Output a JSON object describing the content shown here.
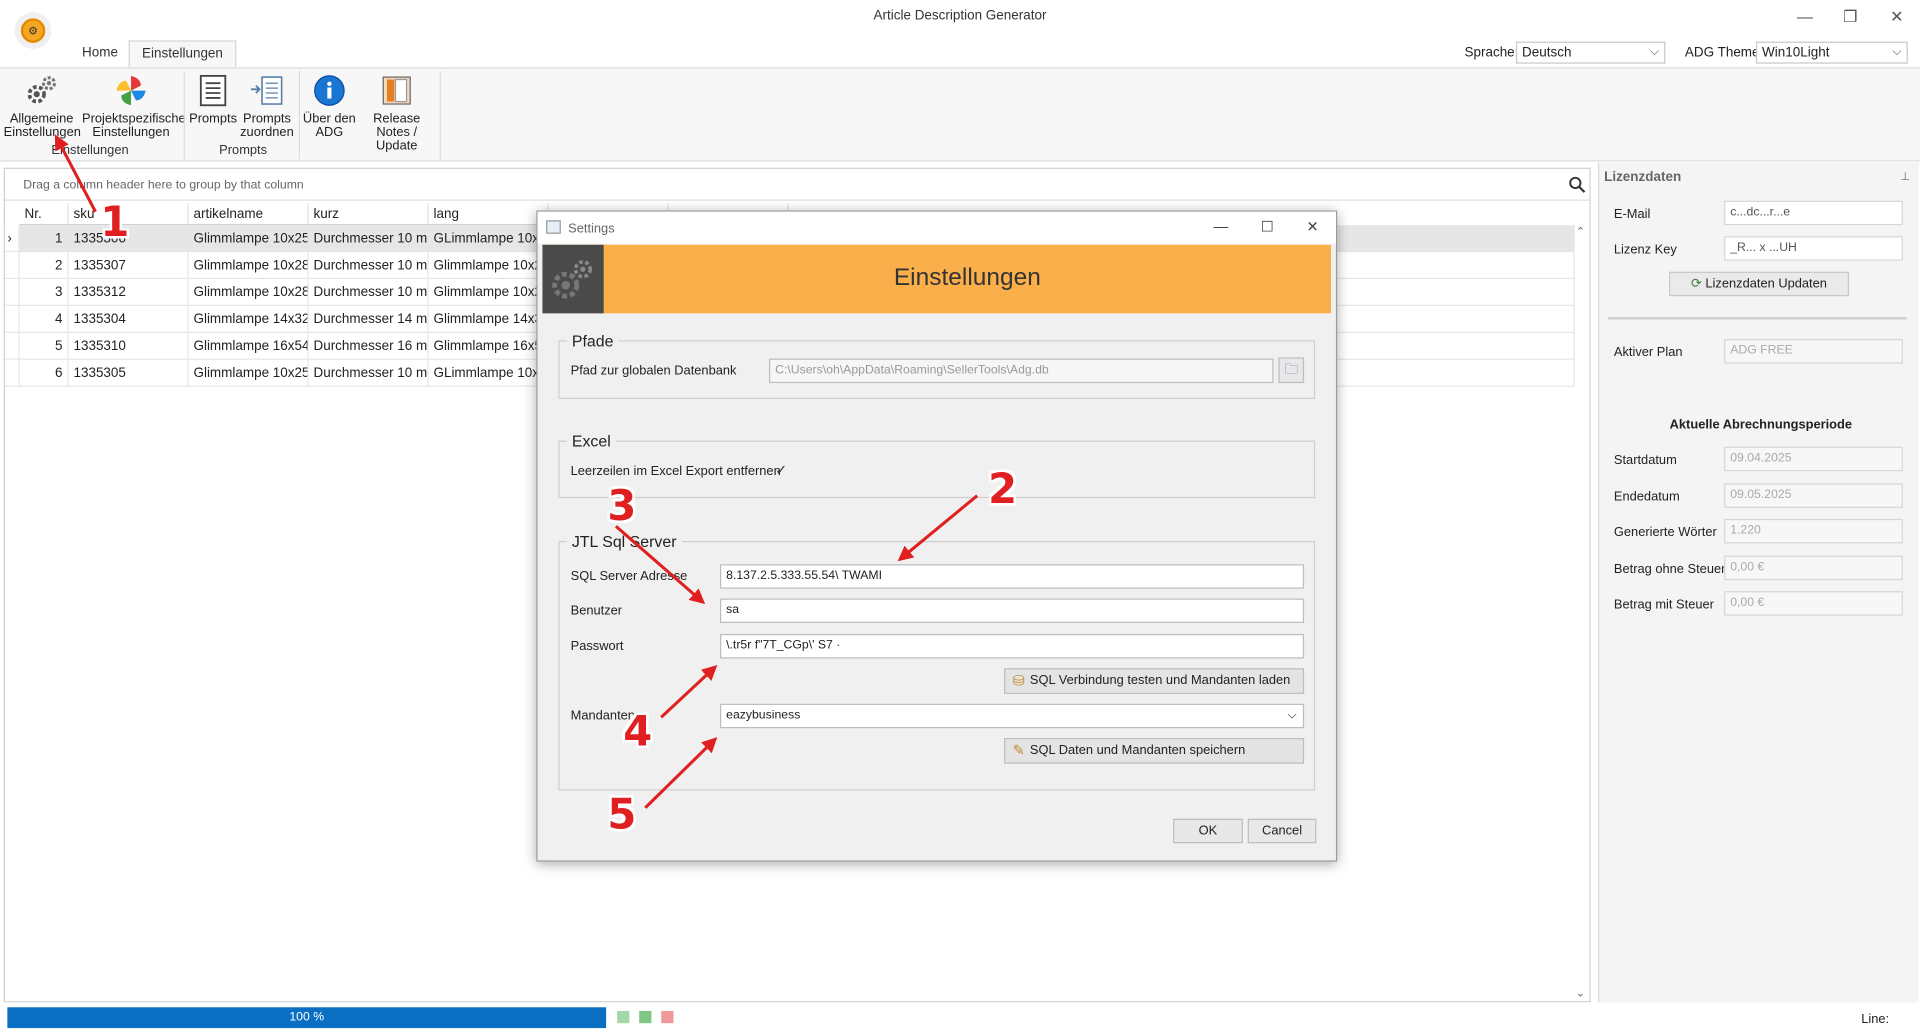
{
  "window": {
    "title": "Article Description Generator",
    "minimize": "—",
    "maximize": "❐",
    "close": "✕"
  },
  "tabs": [
    {
      "label": "Home"
    },
    {
      "label": "Einstellungen"
    }
  ],
  "topbar": {
    "language_label": "Sprache:",
    "language_value": "Deutsch",
    "theme_label": "ADG Theme:",
    "theme_value": "Win10Light",
    "dropdown_arrow": "⌵"
  },
  "ribbon": {
    "general_settings": "Allgemeine Einstellungen",
    "project_settings": "Projektspezifische Einstellungen",
    "prompts": "Prompts",
    "assign_prompts": "Prompts zuordnen",
    "about": "Über den ADG",
    "release_notes": "Release Notes / Update",
    "group_settings": "Einstellungen",
    "group_prompts": "Prompts"
  },
  "grid": {
    "group_hint": "Drag a column header here to group by that column",
    "columns": [
      "Nr.",
      "sku",
      "artikelname",
      "kurz",
      "lang"
    ],
    "rows": [
      {
        "nr": "1",
        "sku": "1335306",
        "name": "Glimmlampe 10x25...",
        "kurz": "Durchmesser 10 m...",
        "lang": "GLimmlampe 10x2..."
      },
      {
        "nr": "2",
        "sku": "1335307",
        "name": "Glimmlampe 10x28...",
        "kurz": "Durchmesser 10 m...",
        "lang": "Glimmlampe 10x2..."
      },
      {
        "nr": "3",
        "sku": "1335312",
        "name": "Glimmlampe 10x28...",
        "kurz": "Durchmesser 10 m...",
        "lang": "Glimmlampe 10x28..."
      },
      {
        "nr": "4",
        "sku": "1335304",
        "name": "Glimmlampe 14x32...",
        "kurz": "Durchmesser 14 m...",
        "lang": "Glimmlampe 14x32..."
      },
      {
        "nr": "5",
        "sku": "1335310",
        "name": "Glimmlampe 16x54...",
        "kurz": "Durchmesser 16 m...",
        "lang": "Glimmlampe 16x54..."
      },
      {
        "nr": "6",
        "sku": "1335305",
        "name": "Glimmlampe 10x25...",
        "kurz": "Durchmesser 10 m...",
        "lang": "GLimmlampe 10x2..."
      }
    ],
    "row_indicator": "›"
  },
  "status": {
    "progress_text": "100 %",
    "progress": 1.0,
    "line_label": "Line:"
  },
  "license": {
    "panel_title": "Lizenzdaten",
    "pin": "📌",
    "email_label": "E-Mail",
    "email_value": "c...dc...r...e",
    "key_label": "Lizenz Key",
    "key_value": "_R... x ...UH",
    "update_button": "Lizenzdaten Updaten",
    "plan_label": "Aktiver Plan",
    "plan_value": "ADG FREE",
    "period_title": "Aktuelle Abrechnungsperiode",
    "start_label": "Startdatum",
    "start_value": "09.04.2025",
    "end_label": "Endedatum",
    "end_value": "09.05.2025",
    "words_label": "Generierte Wörter",
    "words_value": "1.220",
    "net_label": "Betrag ohne Steuer",
    "net_value": "0,00 €",
    "gross_label": "Betrag mit Steuer",
    "gross_value": "0,00 €"
  },
  "dialog": {
    "title": "Settings",
    "banner": "Einstellungen",
    "paths_title": "Pfade",
    "db_path_label": "Pfad zur globalen Datenbank",
    "db_path_value": "C:\\Users\\oh\\AppData\\Roaming\\SellerTools\\Adg.db",
    "excel_title": "Excel",
    "excel_option": "Leerzeilen im Excel Export entfernen",
    "excel_checked": "✓",
    "sql_title": "JTL Sql Server",
    "sql_address_label": "SQL Server Adresse",
    "sql_address_value": "8.137.2.5.333.55.54\\ TWAMI",
    "user_label": "Benutzer",
    "user_value": "sa",
    "password_label": "Passwort",
    "password_value": "\\.tr5r f\"7T_CGp\\' S7 ·",
    "test_button": "SQL Verbindung testen und Mandanten laden",
    "mandanten_label": "Mandanten",
    "mandanten_value": "eazybusiness",
    "save_button": "SQL Daten und Mandanten speichern",
    "ok": "OK",
    "cancel": "Cancel"
  },
  "annotations": [
    "1",
    "2",
    "3",
    "4",
    "5"
  ],
  "colors": {
    "accent_orange": "#fbaf4a",
    "progress_blue": "#0a6fc2",
    "arrow_red": "#e02020"
  }
}
